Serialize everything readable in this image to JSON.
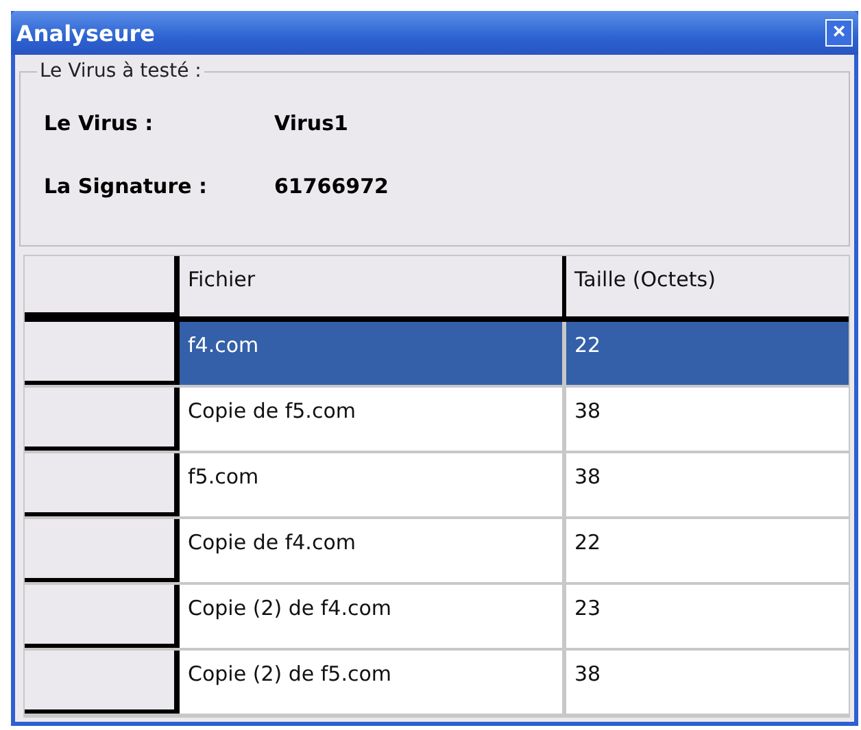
{
  "window": {
    "title": "Analyseure",
    "close": "×"
  },
  "group": {
    "legend": "Le Virus à testé :",
    "fields": [
      {
        "label": "Le Virus :",
        "value": "Virus1"
      },
      {
        "label": "La Signature :",
        "value": "61766972"
      }
    ]
  },
  "table": {
    "columns": [
      "Fichier",
      "Taille (Octets)"
    ],
    "rows": [
      {
        "cells": [
          "f4.com",
          "22"
        ],
        "selected": true
      },
      {
        "cells": [
          "Copie de f5.com",
          "38"
        ],
        "selected": false
      },
      {
        "cells": [
          "f5.com",
          "38"
        ],
        "selected": false
      },
      {
        "cells": [
          "Copie de f4.com",
          "22"
        ],
        "selected": false
      },
      {
        "cells": [
          "Copie (2) de f4.com",
          "23"
        ],
        "selected": false
      },
      {
        "cells": [
          "Copie (2) de f5.com",
          "38"
        ],
        "selected": false
      }
    ]
  }
}
